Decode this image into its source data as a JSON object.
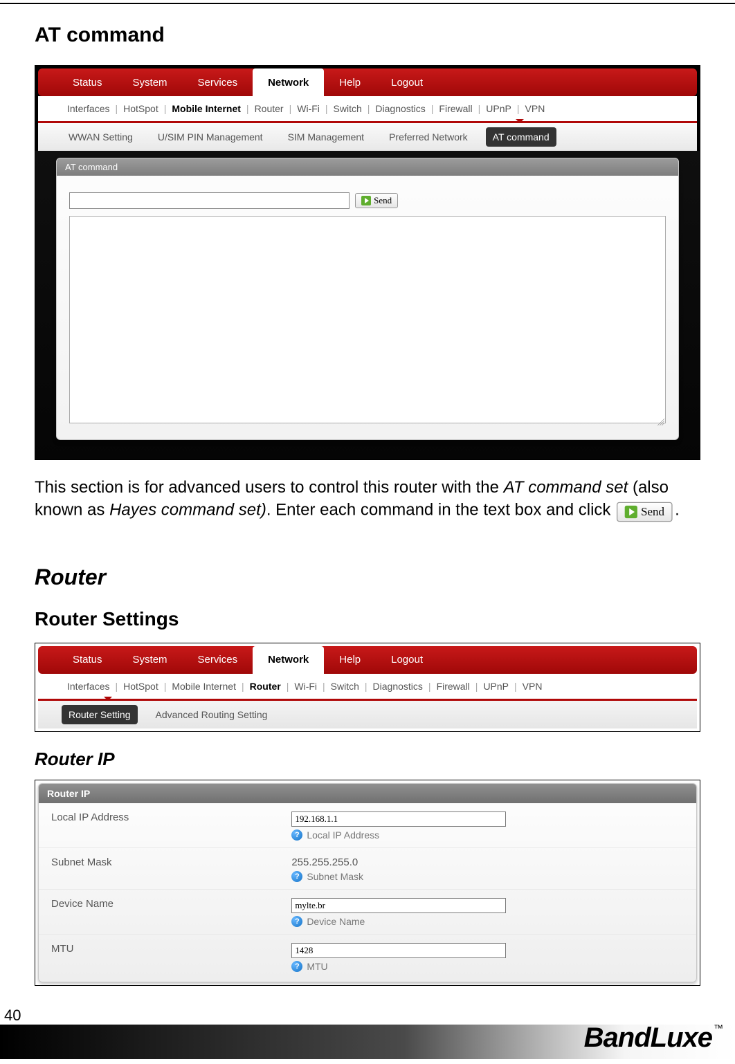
{
  "page_number": "40",
  "brand": {
    "name": "BandLuxe",
    "tm": "™"
  },
  "section_at": {
    "title": "AT command",
    "main_menu_items": [
      "Status",
      "System",
      "Services",
      "Network",
      "Help",
      "Logout"
    ],
    "main_menu_active": "Network",
    "sub_nav_items": [
      "Interfaces",
      "HotSpot",
      "Mobile Internet",
      "Router",
      "Wi-Fi",
      "Switch",
      "Diagnostics",
      "Firewall",
      "UPnP",
      "VPN"
    ],
    "sub_nav_active": "Mobile Internet",
    "tert_items": [
      "WWAN Setting",
      "U/SIM PIN Management",
      "SIM Management",
      "Preferred Network",
      "AT command"
    ],
    "tert_active": "AT command",
    "panel_title": "AT command",
    "send_label": "Send",
    "cmd_value": "",
    "output_value": ""
  },
  "explain": {
    "p1_a": "This section is for advanced users to control this router with the ",
    "p1_b": "AT command set",
    "p1_c": " (also known as ",
    "p1_d": "Hayes command set)",
    "p1_e": ". Enter each command in the text box and click ",
    "p1_f": ".",
    "inline_send_label": "Send"
  },
  "section_router": {
    "heading": "Router",
    "settings_title": "Router Settings",
    "main_menu_items": [
      "Status",
      "System",
      "Services",
      "Network",
      "Help",
      "Logout"
    ],
    "main_menu_active": "Network",
    "sub_nav_items": [
      "Interfaces",
      "HotSpot",
      "Mobile Internet",
      "Router",
      "Wi-Fi",
      "Switch",
      "Diagnostics",
      "Firewall",
      "UPnP",
      "VPN"
    ],
    "sub_nav_active": "Router",
    "tert_items": [
      "Router Setting",
      "Advanced Routing Setting"
    ],
    "tert_active": "Router Setting"
  },
  "section_router_ip": {
    "heading": "Router IP",
    "panel_title": "Router IP",
    "rows": {
      "local_ip": {
        "label": "Local IP Address",
        "value": "192.168.1.1",
        "help": "Local IP Address"
      },
      "subnet": {
        "label": "Subnet Mask",
        "value": "255.255.255.0",
        "help": "Subnet Mask"
      },
      "device": {
        "label": "Device Name",
        "value": "mylte.br",
        "help": "Device Name"
      },
      "mtu": {
        "label": "MTU",
        "value": "1428",
        "help": "MTU"
      }
    }
  }
}
